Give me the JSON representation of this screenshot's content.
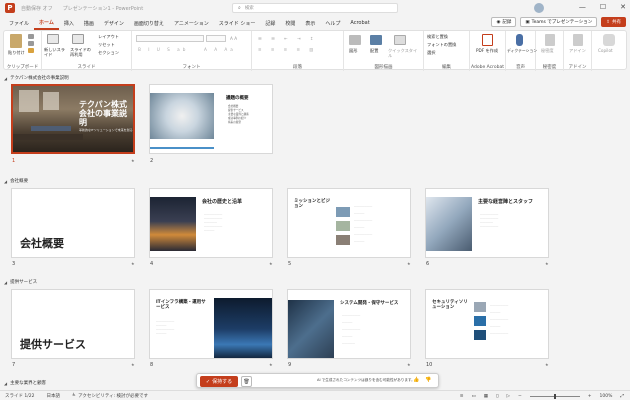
{
  "titlebar": {
    "autosave": "自動保存 オフ",
    "doc_title": "プレゼンテーション1 - PowerPoint",
    "search_placeholder": "検索",
    "minimize": "—",
    "maximize": "☐",
    "close": "✕"
  },
  "menu": {
    "tabs": [
      "ファイル",
      "ホーム",
      "挿入",
      "描画",
      "デザイン",
      "画面切り替え",
      "アニメーション",
      "スライド ショー",
      "記録",
      "校閲",
      "表示",
      "ヘルプ",
      "Acrobat"
    ],
    "active_index": 1,
    "record_label": "記録",
    "teams_label": "Teams でプレゼンテーション",
    "share_label": "共有"
  },
  "ribbon": {
    "groups": [
      {
        "label": "クリップボード",
        "items": [
          "貼り付け"
        ]
      },
      {
        "label": "スライド",
        "items": [
          "新しいスライド",
          "スライドの再利用",
          "レイアウト",
          "リセット",
          "セクション"
        ]
      },
      {
        "label": "フォント",
        "items": []
      },
      {
        "label": "段落",
        "items": []
      },
      {
        "label": "図形描画",
        "items": [
          "図形",
          "配置",
          "クイックスタイル"
        ]
      },
      {
        "label": "編集",
        "items": [
          "検索と置換",
          "フォントの置換",
          "選択"
        ]
      },
      {
        "label": "Adobe Acrobat",
        "items": [
          "PDF を作成"
        ]
      },
      {
        "label": "音声",
        "items": [
          "ディクテーション"
        ]
      },
      {
        "label": "秘密度",
        "items": [
          "秘密度"
        ]
      },
      {
        "label": "アドイン",
        "items": [
          "アドイン"
        ]
      },
      {
        "label": "",
        "items": [
          "Copilot"
        ]
      }
    ]
  },
  "sections": [
    {
      "name": "テクパン株式会社の事業説明"
    },
    {
      "name": "会社概要"
    },
    {
      "name": "提供サービス"
    },
    {
      "name": "主要な業界と顧客"
    }
  ],
  "slides": [
    {
      "num": "1",
      "title": "テクパン株式会社の事業説明",
      "subtitle": "革新的なITソリューションで未来を創る"
    },
    {
      "num": "2",
      "title": "議題の概要",
      "bullets": [
        "会社概要",
        "提供サービス",
        "主要な業界と顧客",
        "成功事例の紹介",
        "将来の展望"
      ]
    },
    {
      "num": "3",
      "title": "会社概要"
    },
    {
      "num": "4",
      "title": "会社の歴史と沿革"
    },
    {
      "num": "5",
      "title": "ミッションとビジョン"
    },
    {
      "num": "6",
      "title": "主要な経営陣とスタッフ"
    },
    {
      "num": "7",
      "title": "提供サービス"
    },
    {
      "num": "8",
      "title": "ITインフラ構築・運用サービス"
    },
    {
      "num": "9",
      "title": "システム開発・保守サービス"
    },
    {
      "num": "10",
      "title": "セキュリティソリューション"
    }
  ],
  "savebar": {
    "save_label": "保持する",
    "message": "AI で生成されたコンテンツは誤りを含む可能性があります。"
  },
  "status": {
    "slide_info": "スライド 1/22",
    "lang": "日本語",
    "accessibility": "アクセシビリティ: 検討が必要です",
    "zoom": "100%"
  },
  "colors": {
    "accent": "#c43e1c",
    "blue": "#4a90c8"
  }
}
